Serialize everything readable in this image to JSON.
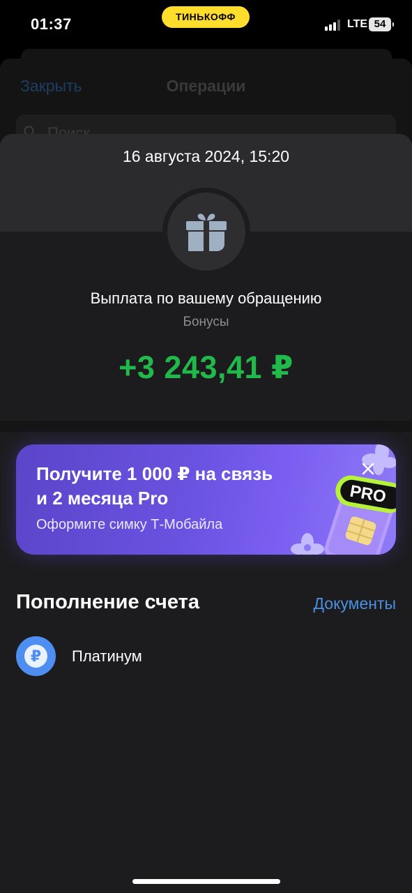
{
  "status_bar": {
    "time": "01:37",
    "carrier_badge": "ТИНЬКОФФ",
    "network": "LTE",
    "battery": "54"
  },
  "background_screen": {
    "close_label": "Закрыть",
    "title": "Операции",
    "search_placeholder": "Поиск"
  },
  "operation": {
    "date": "16 августа 2024, 15:20",
    "title": "Выплата по вашему обращению",
    "category": "Бонусы",
    "amount": "+3 243,41 ₽",
    "amount_color": "#21b94a",
    "icon": "gift-icon"
  },
  "promo": {
    "title_line1": "Получите 1 000 ₽ на связь",
    "title_line2": "и 2 месяца Pro",
    "subtitle": "Оформите симку Т-Мобайла",
    "badge": "PRO"
  },
  "section": {
    "title": "Пополнение счета",
    "link": "Документы"
  },
  "account": {
    "name": "Платинум",
    "icon_symbol": "₽",
    "icon_color": "#4e8ef0"
  },
  "colors": {
    "accent_blue": "#4a90e2",
    "brand_yellow": "#ffdd2d",
    "promo_purple": "#6a52e0"
  }
}
